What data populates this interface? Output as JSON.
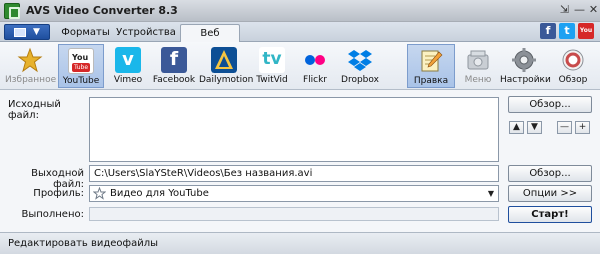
{
  "window": {
    "title": "AVS Video Converter 8.3",
    "controls": {
      "pin": "⇲",
      "minimize": "—",
      "close": "✕"
    }
  },
  "tabs": {
    "items": [
      "Форматы",
      "Устройства",
      "Веб"
    ],
    "active": "Веб"
  },
  "social": [
    {
      "name": "facebook",
      "letter": "f",
      "color": "#3b5998"
    },
    {
      "name": "twitter",
      "letter": "t",
      "color": "#1da1f2"
    },
    {
      "name": "youtube",
      "letter": "You",
      "color": "#d62828"
    }
  ],
  "toolbar": {
    "items": [
      {
        "label": "Избранное",
        "icon": "star-icon",
        "selected": false,
        "disabled": true,
        "color": "#e7b22d"
      },
      {
        "label": "YouTube",
        "icon": "youtube-icon",
        "selected": true,
        "disabled": false,
        "color": "#d62828"
      },
      {
        "label": "Vimeo",
        "icon": "vimeo-icon",
        "selected": false,
        "disabled": false,
        "color": "#1ab7ea"
      },
      {
        "label": "Facebook",
        "icon": "facebook-icon",
        "selected": false,
        "disabled": false,
        "color": "#3b5998"
      },
      {
        "label": "Dailymotion",
        "icon": "dailymotion-icon",
        "selected": false,
        "disabled": false,
        "color": "#0d4f95"
      },
      {
        "label": "TwitVid",
        "icon": "twitvid-icon",
        "selected": false,
        "disabled": false,
        "color": "#32b6c6"
      },
      {
        "label": "Flickr",
        "icon": "flickr-icon",
        "selected": false,
        "disabled": false,
        "color": "#ff0084"
      },
      {
        "label": "Dropbox",
        "icon": "dropbox-icon",
        "selected": false,
        "disabled": false,
        "color": "#007ee5"
      }
    ],
    "right": [
      {
        "label": "Правка",
        "icon": "edit-icon",
        "selected": true,
        "disabled": false
      },
      {
        "label": "Меню",
        "icon": "menu-icon",
        "selected": false,
        "disabled": true
      },
      {
        "label": "Настройки",
        "icon": "gear-icon",
        "selected": false,
        "disabled": false
      },
      {
        "label": "Обзор",
        "icon": "help-icon",
        "selected": false,
        "disabled": false
      }
    ]
  },
  "form": {
    "source_label": "Исходный файл:",
    "output_label": "Выходной файл:",
    "profile_label": "Профиль:",
    "progress_label": "Выполнено:",
    "output_value": "C:\\Users\\SlaYSteR\\Videos\\Без названия.avi",
    "profile_value": "Видео для YouTube",
    "progress_value": 0
  },
  "buttons": {
    "browse_source": "Обзор...",
    "browse_output": "Обзор...",
    "options": "Опции >>",
    "start": "Старт!"
  },
  "mini_buttons": {
    "up": "▲",
    "down": "▼",
    "minus": "—",
    "plus": "+"
  },
  "status": {
    "text": "Редактировать видеофайлы"
  }
}
